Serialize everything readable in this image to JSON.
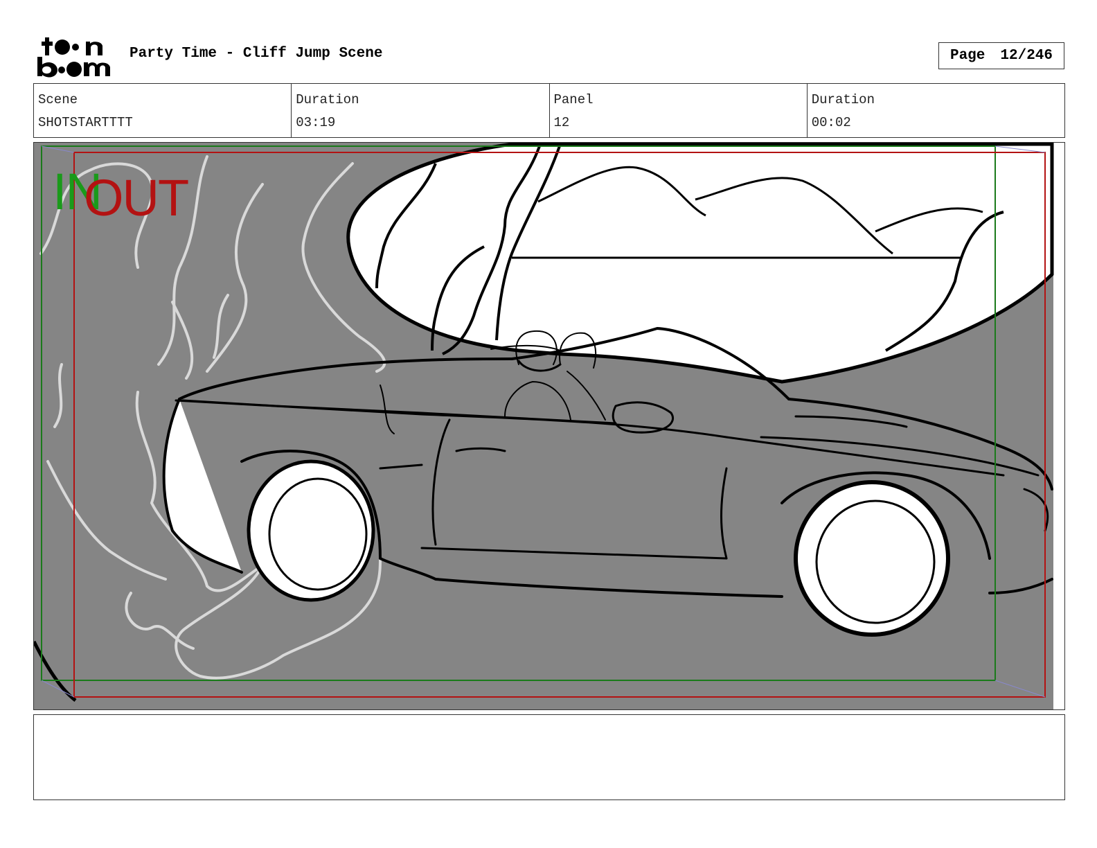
{
  "header": {
    "logo_text": "toon boom",
    "project_title": "Party Time - Cliff Jump Scene",
    "page_label": "Page",
    "page_number": "12/246"
  },
  "info": [
    {
      "label": "Scene",
      "value": "SHOTSTARTTTT"
    },
    {
      "label": "Duration",
      "value": "03:19"
    },
    {
      "label": "Panel",
      "value": "12"
    },
    {
      "label": "Duration",
      "value": "00:02"
    }
  ],
  "panel": {
    "in_marker": "IN",
    "out_marker": "OUT",
    "colors": {
      "background_gray": "#858585",
      "in_frame": "#1a7a1a",
      "out_frame": "#b31212",
      "sketch_line": "#000000",
      "smoke_line": "#d9d9d9"
    }
  },
  "notes": {
    "text": ""
  }
}
